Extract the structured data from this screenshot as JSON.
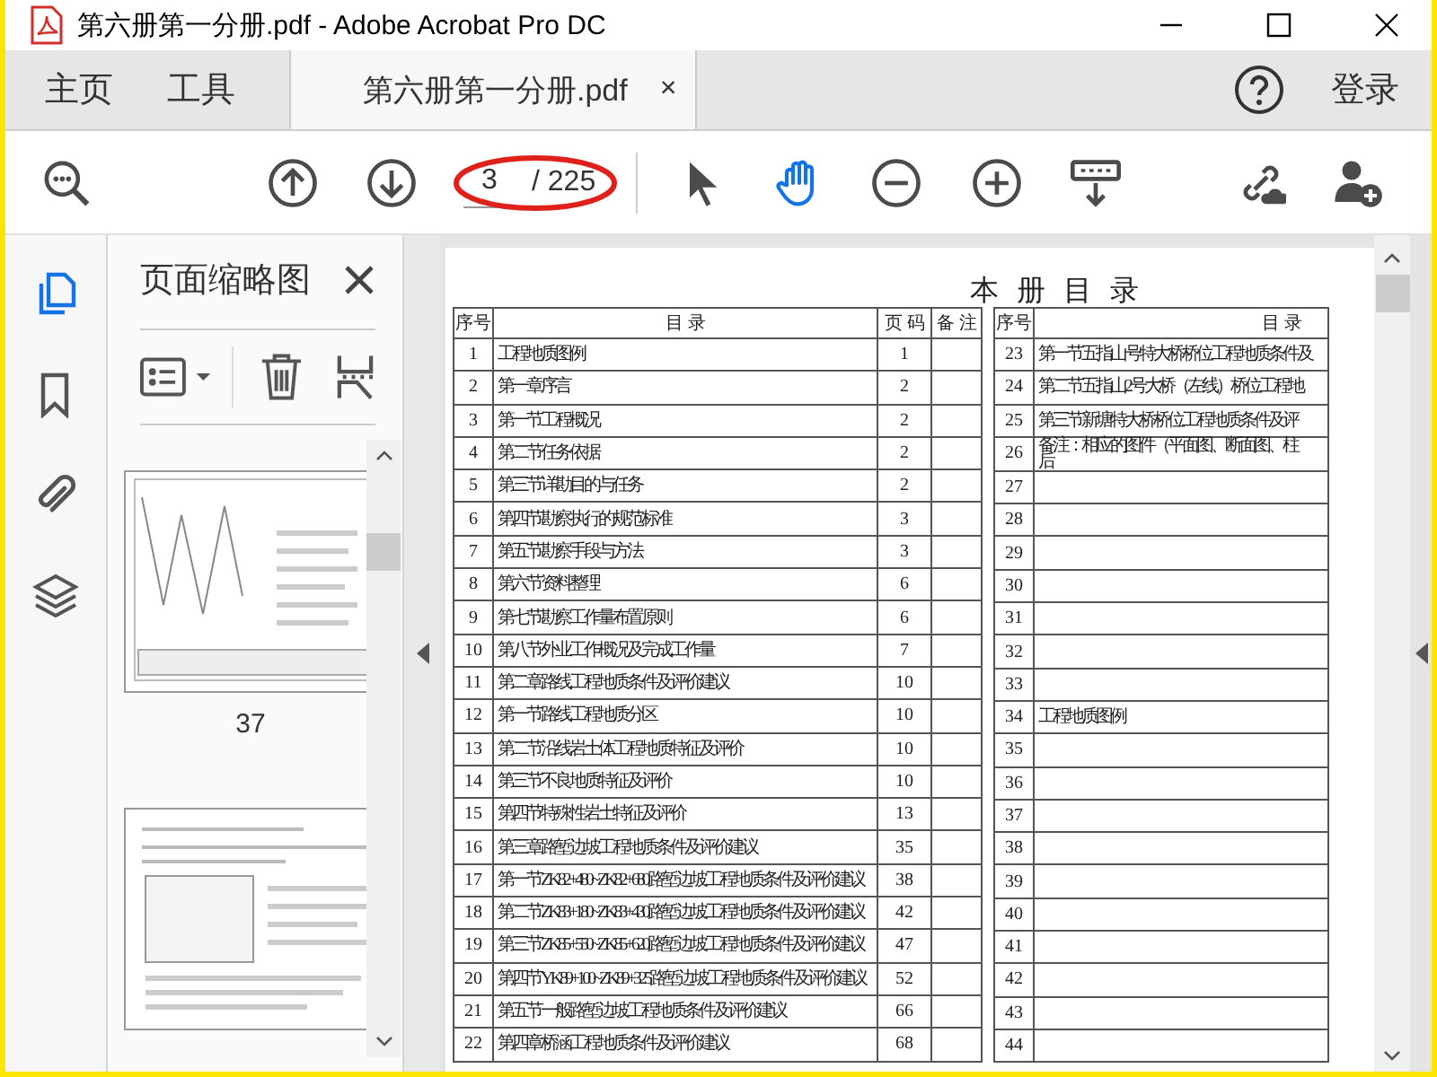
{
  "window": {
    "title": "第六册第一分册.pdf - Adobe Acrobat Pro DC"
  },
  "tabs": [
    {
      "label": "主页",
      "selected": false
    },
    {
      "label": "工具",
      "selected": false
    },
    {
      "label": "第六册第一分册.pdf",
      "selected": true,
      "close": "×"
    }
  ],
  "sign_in": "登录",
  "toolbar": {
    "page_number": "3",
    "page_total": "/ 225",
    "tools": [
      {
        "kind": "find",
        "selected": false
      },
      {
        "kind": "prev",
        "selected": false
      },
      {
        "kind": "next",
        "selected": false
      },
      {
        "kind": "page"
      },
      {
        "kind": "select",
        "selected": false
      },
      {
        "kind": "hand",
        "selected": true
      },
      {
        "kind": "zoom-out",
        "selected": false
      },
      {
        "kind": "zoom-in",
        "selected": false
      },
      {
        "kind": "fit",
        "selected": false
      },
      {
        "kind": "share-link",
        "selected": false
      },
      {
        "kind": "add-user",
        "selected": false
      }
    ]
  },
  "side_rail": [
    {
      "kind": "pages",
      "selected": true
    },
    {
      "kind": "bookmarks",
      "selected": false
    },
    {
      "kind": "attachments",
      "selected": false
    },
    {
      "kind": "layers",
      "selected": false
    }
  ],
  "thumbnails_panel": {
    "title": "页面缩略图",
    "thumbnails": [
      {
        "kind": "picture",
        "label": "37"
      },
      {
        "kind": "picture"
      }
    ]
  },
  "document": {
    "title": "本 册 目 录",
    "tables": [
      {
        "columns": [
          "序号",
          "目 录",
          "页 码",
          "备 注"
        ],
        "rows": [
          {
            "no": "1",
            "title": "工程地质图例",
            "page": "1"
          },
          {
            "no": "2",
            "title": "第一章序言",
            "page": "2"
          },
          {
            "no": "3",
            "title": "第一节工程概况",
            "page": "2"
          },
          {
            "no": "4",
            "title": "第二节任务依据",
            "page": "2"
          },
          {
            "no": "5",
            "title": "第三节详勘目的与任务",
            "page": "2"
          },
          {
            "no": "6",
            "title": "第四节勘察执行的规范标准",
            "page": "3"
          },
          {
            "no": "7",
            "title": "第五节勘察手段与方法",
            "page": "3"
          },
          {
            "no": "8",
            "title": "第六节资料整理",
            "page": "6"
          },
          {
            "no": "9",
            "title": "第七节勘察工作量布置原则",
            "page": "6"
          },
          {
            "no": "10",
            "title": "第八节外业工作概况及完成工作量",
            "page": "7"
          },
          {
            "no": "11",
            "title": "第二章路线工程地质条件及评价建议",
            "page": "10"
          },
          {
            "no": "12",
            "title": "第一节路线工程地质分区",
            "page": "10"
          },
          {
            "no": "13",
            "title": "第二节沿线岩土体工程地质特征及评价",
            "page": "10"
          },
          {
            "no": "14",
            "title": "第三节不良地质特征及评价",
            "page": "10"
          },
          {
            "no": "15",
            "title": "第四节特殊性岩土特征及评价",
            "page": "13"
          },
          {
            "no": "16",
            "title": "第三章路堑边坡工程地质条件及评价建议",
            "page": "35"
          },
          {
            "no": "17",
            "title": "第一节ZK82+480~ZK82+680路堑边坡工程地质条件及评价建议",
            "page": "38"
          },
          {
            "no": "18",
            "title": "第二节ZK83+180~ZK83+430路堑边坡工程地质条件及评价建议",
            "page": "42"
          },
          {
            "no": "19",
            "title": "第三节ZK85+550~ZK85+620路堑边坡工程地质条件及评价建议",
            "page": "47"
          },
          {
            "no": "20",
            "title": "第四节YK89+100~ZK89+325路堑边坡工程地质条件及评价建议",
            "page": "52"
          },
          {
            "no": "21",
            "title": "第五节一般路堑边坡工程地质条件及评价建议",
            "page": "66"
          },
          {
            "no": "22",
            "title": "第四章桥涵工程地质条件及评价建议",
            "page": "68"
          }
        ]
      },
      {
        "columns": [
          "序号",
          "目 录"
        ],
        "rows": [
          {
            "no": "23",
            "title": "第一节五指山号特大桥桥位工程地质条件及"
          },
          {
            "no": "24",
            "title": "第二节五指山2号大桥（左线）桥位工程地"
          },
          {
            "no": "25",
            "title": "第三节新塘特大桥桥位工程地质条件及评"
          },
          {
            "no": "26",
            "title_lines": [
              "备注：相应的图件（平面图、断面图、柱",
              "后"
            ]
          },
          {
            "no": "27"
          },
          {
            "no": "28"
          },
          {
            "no": "29"
          },
          {
            "no": "30"
          },
          {
            "no": "31"
          },
          {
            "no": "32"
          },
          {
            "no": "33"
          },
          {
            "no": "34",
            "title": "工程地质图例"
          },
          {
            "no": "35"
          },
          {
            "no": "36"
          },
          {
            "no": "37"
          },
          {
            "no": "38"
          },
          {
            "no": "39"
          },
          {
            "no": "40"
          },
          {
            "no": "41"
          },
          {
            "no": "42"
          },
          {
            "no": "43"
          },
          {
            "no": "44"
          }
        ]
      }
    ]
  }
}
